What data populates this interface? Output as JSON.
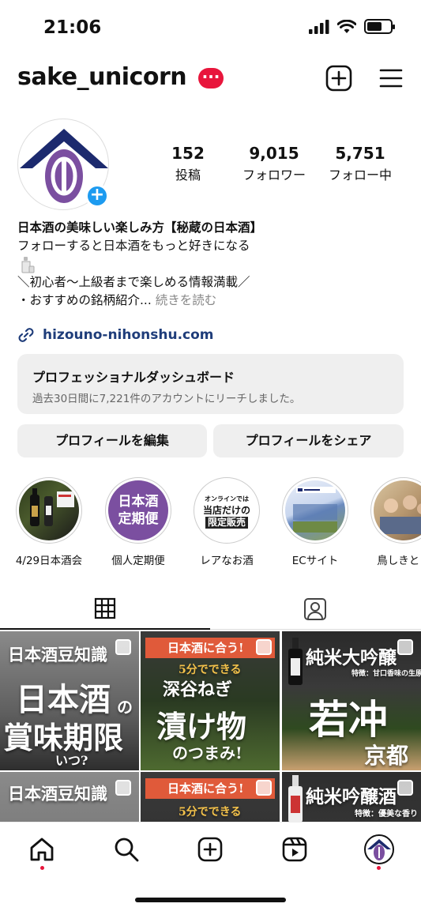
{
  "status_bar": {
    "time": "21:06",
    "icons": [
      "signal-icon",
      "wifi-icon",
      "battery-icon"
    ]
  },
  "header": {
    "username": "sake_unicorn",
    "badge": "···",
    "icons": [
      "new-post-icon",
      "menu-icon"
    ]
  },
  "profile": {
    "stats": [
      {
        "value": "152",
        "label": "投稿"
      },
      {
        "value": "9,015",
        "label": "フォロワー"
      },
      {
        "value": "5,751",
        "label": "フォロー中"
      }
    ],
    "bio": {
      "name": "日本酒の美味しい楽しみ方【秘蔵の日本酒】",
      "line1": "フォローすると日本酒をもっと好きになる",
      "line3": "＼初心者〜上級者まで楽しめる情報満載／",
      "line4": "・おすすめの銘柄紹介...",
      "more": "続きを読む"
    },
    "link": "hizouno-nihonshu.com"
  },
  "dashboard": {
    "title": "プロフェッショナルダッシュボード",
    "subtitle": "過去30日間に7,221件のアカウントにリーチしました。"
  },
  "actions": {
    "edit": "プロフィールを編集",
    "share": "プロフィールをシェア"
  },
  "highlights": [
    {
      "label": "4/29日本酒会"
    },
    {
      "label": "個人定期便",
      "cover_text1": "日本酒",
      "cover_text2": "定期便"
    },
    {
      "label": "レアなお酒",
      "cover_text1": "オンラインでは",
      "cover_text2": "当店だけの",
      "cover_text3": "限定販売"
    },
    {
      "label": "ECサイト"
    },
    {
      "label": "鳥しきと日"
    }
  ],
  "posts": [
    {
      "t1": "日本酒豆知識",
      "t2": "日本酒",
      "t3": "の",
      "t4": "賞味期限",
      "t5": "いつ?"
    },
    {
      "t1": "日本酒に合う!",
      "t2": "5分でできる",
      "t3": "深谷ねぎ",
      "t4": "漬け物",
      "t5": "のつまみ!"
    },
    {
      "t1": "純米大吟醸",
      "t2": "特徴：甘口香味の生原酒",
      "t3": "若冲",
      "t4": "京都"
    },
    {
      "t1": "日本酒豆知識"
    },
    {
      "t1": "日本酒に合う!",
      "t2": "5分でできる"
    },
    {
      "t1": "純米吟醸酒",
      "t2": "特徴：優美な香り"
    }
  ],
  "colors": {
    "badge": "#e8163c",
    "link": "#1f3d7a",
    "plus": "#1d9bf0",
    "logo_navy": "#1c2a6e",
    "logo_purple": "#7b4fa0"
  }
}
